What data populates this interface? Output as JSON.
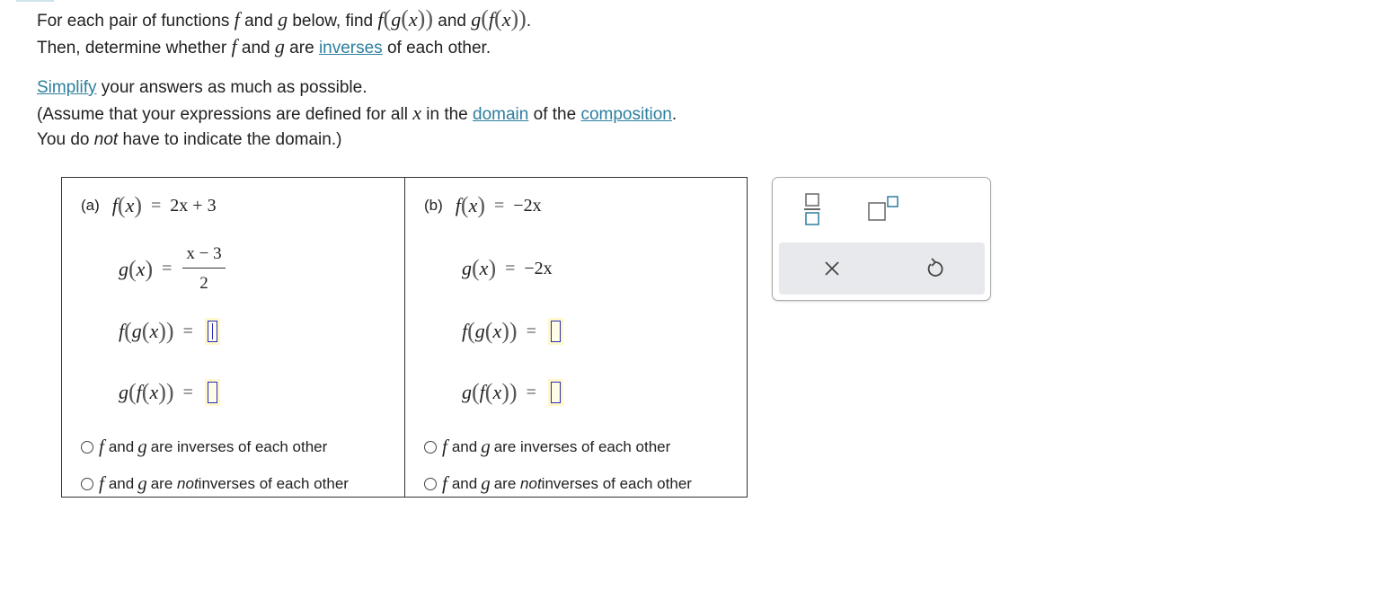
{
  "instructions": {
    "line1_a": "For each pair of functions ",
    "line1_f": "f",
    "line1_b": " and ",
    "line1_g": "g",
    "line1_c": " below, find ",
    "line1_d": " and ",
    "line2_a": "Then, determine whether ",
    "line2_f": "f",
    "line2_b": " and ",
    "line2_g": "g",
    "line2_c": " are ",
    "link_inverses": "inverses",
    "line2_d": " of each other.",
    "link_simplify": "Simplify",
    "line3": " your answers as much as possible.",
    "line4_a": "(Assume that your expressions are defined for all ",
    "line4_x": "x",
    "line4_b": " in the ",
    "link_domain": "domain",
    "line4_c": " of the ",
    "link_composition": "composition",
    "line4_d": ".",
    "line5_a": "You do ",
    "line5_not": "not",
    "line5_b": " have to indicate the domain.)"
  },
  "part_a": {
    "label": "(a)",
    "f_def": "2x + 3",
    "g_num": "x − 3",
    "g_den": "2",
    "fg_value": "",
    "gf_value": "",
    "option1_text": "are inverses of each other",
    "option2_pre": "are ",
    "option2_not": "not",
    "option2_post": " inverses of each other"
  },
  "part_b": {
    "label": "(b)",
    "f_def": "−2x",
    "g_def": "−2x",
    "fg_value": "",
    "gf_value": "",
    "option1_text": "are inverses of each other",
    "option2_pre": "are ",
    "option2_not": "not",
    "option2_post": " inverses of each other"
  },
  "symbols": {
    "f": "f",
    "g": "g",
    "x": "x",
    "and": "and",
    "eq": "="
  },
  "palette": {
    "icons": [
      "fraction-icon",
      "superscript-icon",
      "clear-icon",
      "undo-icon"
    ]
  },
  "colors": {
    "link": "#2d7f9e",
    "answer_border": "#2a2bb8",
    "answer_bg": "#fffde6",
    "action_bar": "#e8e9ec"
  }
}
